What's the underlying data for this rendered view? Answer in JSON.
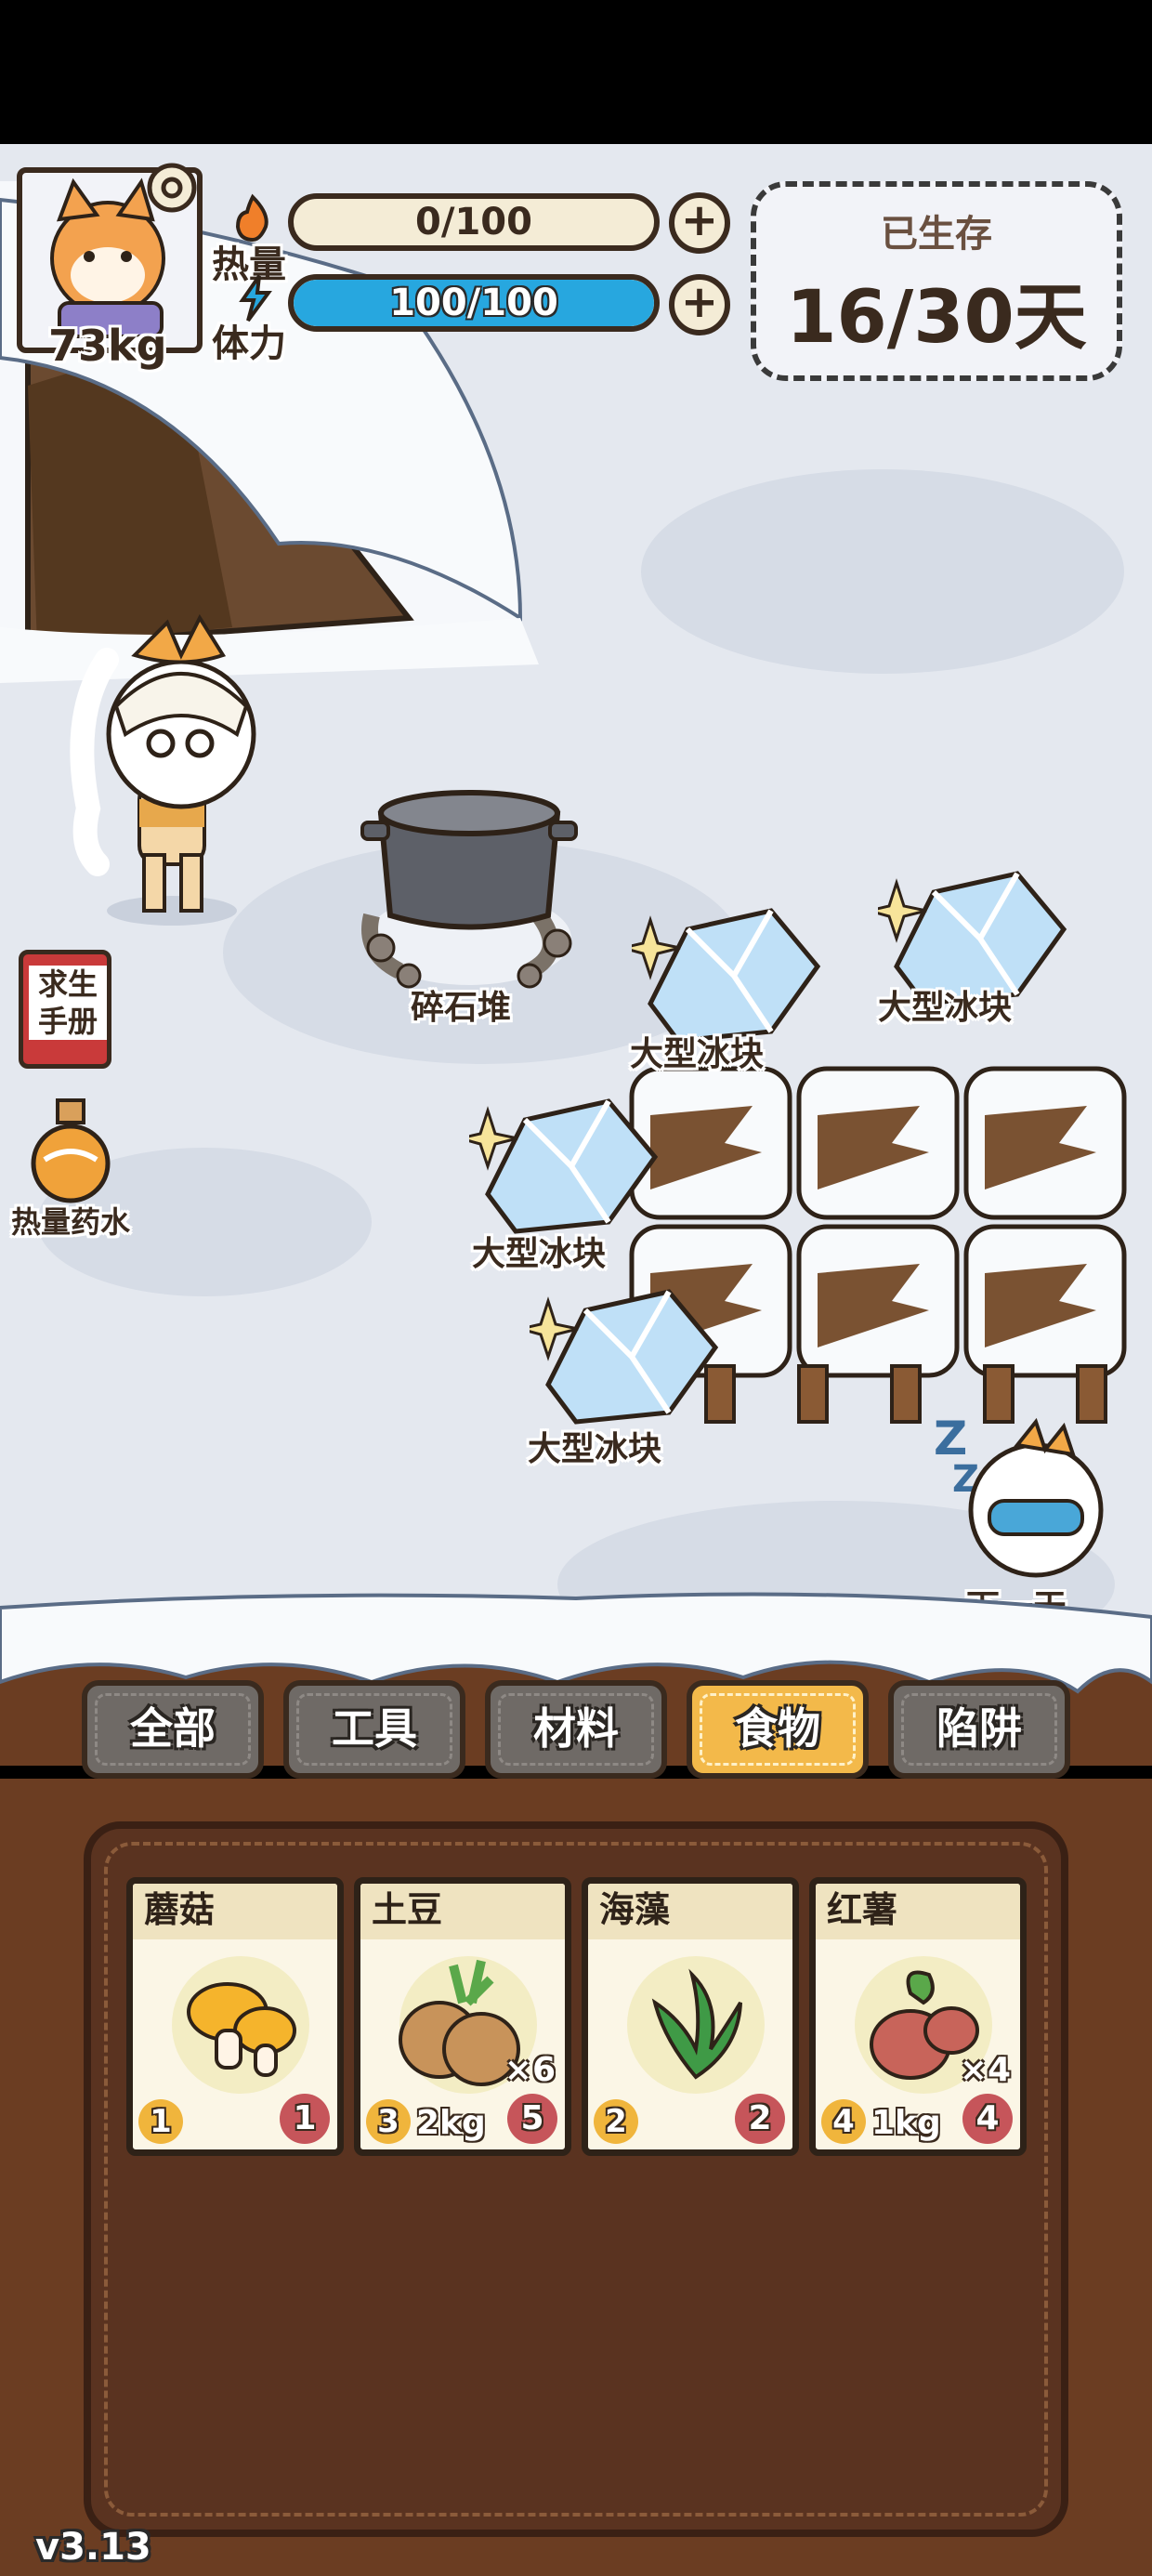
{
  "player": {
    "weight": "73kg"
  },
  "stats": {
    "heat": {
      "label": "热量",
      "value_text": "0/100",
      "fraction": 0.0
    },
    "stamina": {
      "label": "体力",
      "value_text": "100/100",
      "fraction": 1.0
    }
  },
  "survival": {
    "label": "已生存",
    "days_text": "16/30天"
  },
  "scene_objects": {
    "rubble": "碎石堆",
    "ice1": "大型冰块",
    "ice2": "大型冰块",
    "ice3": "大型冰块",
    "ice4": "大型冰块",
    "next_day": "下一天"
  },
  "side": {
    "manual": "求生手册",
    "potion": "热量药水"
  },
  "tabs": [
    {
      "label": "全部",
      "active": false
    },
    {
      "label": "工具",
      "active": false
    },
    {
      "label": "材料",
      "active": false
    },
    {
      "label": "食物",
      "active": true
    },
    {
      "label": "陷阱",
      "active": false
    }
  ],
  "inventory": [
    {
      "name": "蘑菇",
      "count": "",
      "heat": "1",
      "weight": "",
      "hunger": "1",
      "icon": "mushroom-icon"
    },
    {
      "name": "土豆",
      "count": "×6",
      "heat": "3",
      "weight": "2kg",
      "hunger": "5",
      "icon": "potato-icon"
    },
    {
      "name": "海藻",
      "count": "",
      "heat": "2",
      "weight": "",
      "hunger": "2",
      "icon": "seaweed-icon"
    },
    {
      "name": "红薯",
      "count": "×4",
      "heat": "4",
      "weight": "1kg",
      "hunger": "4",
      "icon": "sweet-potato-icon"
    }
  ],
  "version": "v3.13",
  "colors": {
    "accent": "#f3b94a",
    "stamina_blue": "#27a7df",
    "wood": "#6b3d22",
    "hunger_red": "#c6555a"
  }
}
